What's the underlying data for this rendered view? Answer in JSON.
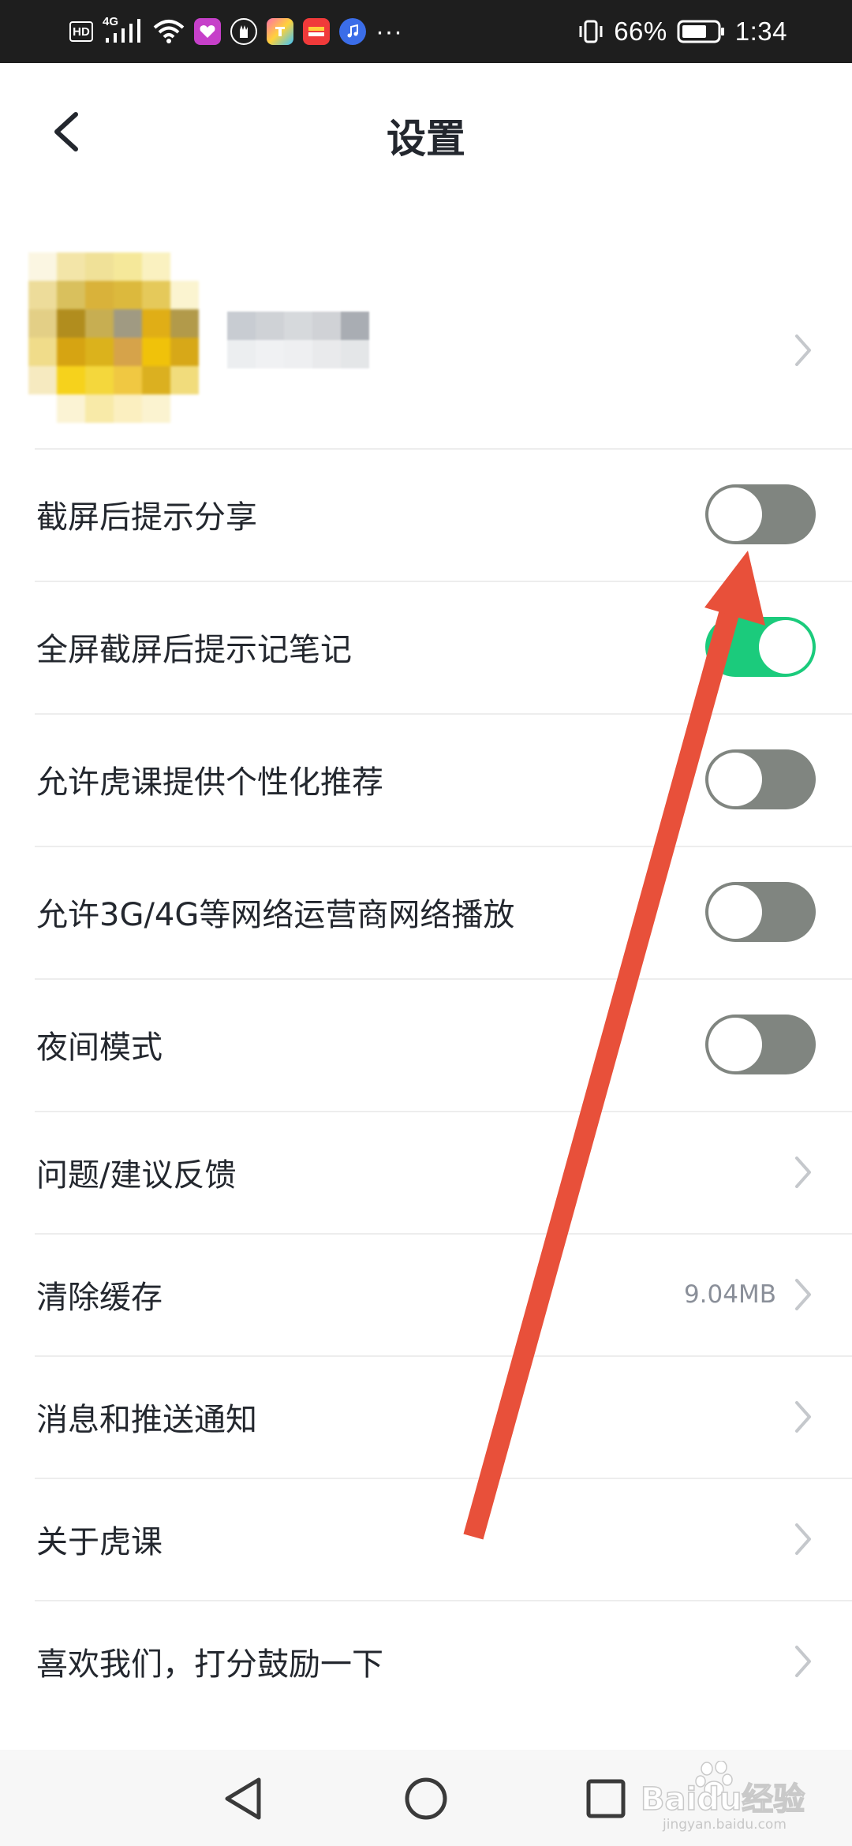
{
  "status_bar": {
    "hd": "HD",
    "network": "4G",
    "battery_percent": "66%",
    "time": "1:34",
    "more": "···",
    "icons": [
      "hd-icon",
      "signal-icon",
      "wifi-icon",
      "app-icon",
      "app-icon",
      "app-icon",
      "app-icon",
      "app-icon",
      "vibrate-icon",
      "battery-icon"
    ]
  },
  "header": {
    "title": "设置",
    "back_icon": "chevron-left-icon"
  },
  "profile": {
    "avatar": "pixelated-avatar",
    "chevron_icon": "chevron-right-icon"
  },
  "settings": [
    {
      "label": "截屏后提示分享",
      "type": "toggle",
      "on": false
    },
    {
      "label": "全屏截屏后提示记笔记",
      "type": "toggle",
      "on": true
    },
    {
      "label": "允许虎课提供个性化推荐",
      "type": "toggle",
      "on": false
    },
    {
      "label": "允许3G/4G等网络运营商网络播放",
      "type": "toggle",
      "on": false
    },
    {
      "label": "夜间模式",
      "type": "toggle",
      "on": false
    },
    {
      "label": "问题/建议反馈",
      "type": "link"
    },
    {
      "label": "清除缓存",
      "type": "link",
      "value": "9.04MB"
    },
    {
      "label": "消息和推送通知",
      "type": "link"
    },
    {
      "label": "关于虎课",
      "type": "link"
    },
    {
      "label": "喜欢我们，打分鼓励一下",
      "type": "link"
    }
  ],
  "nav_bar": {
    "icons": [
      "back-triangle-icon",
      "home-circle-icon",
      "recents-square-icon"
    ]
  },
  "watermark": {
    "text": "Baidu经验",
    "sub": "jingyan.baidu.com"
  },
  "colors": {
    "toggle_on": "#1bcb7c",
    "toggle_off": "#808580",
    "annotation_arrow": "#e8503a",
    "status_bar_bg": "#1e1e1e"
  }
}
